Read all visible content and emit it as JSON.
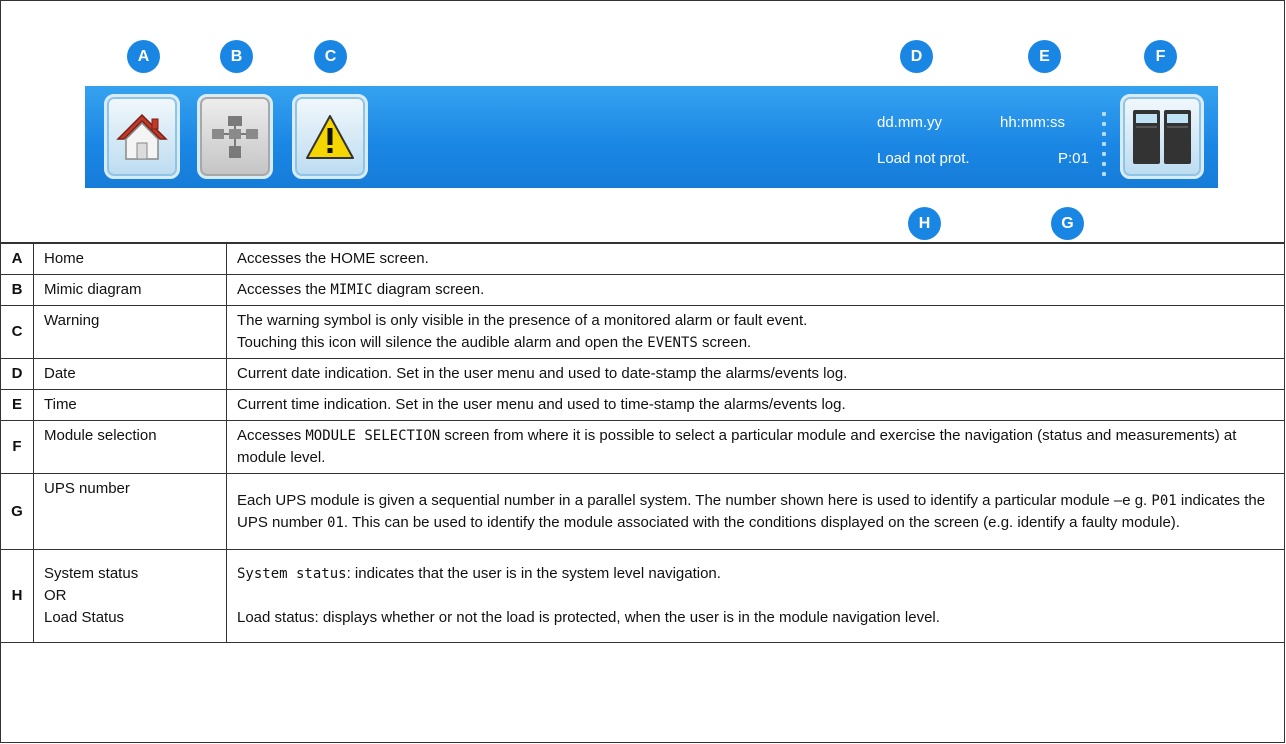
{
  "figure": {
    "badges": [
      "A",
      "B",
      "C",
      "D",
      "E",
      "F",
      "H",
      "G"
    ],
    "status_bar": {
      "date": "dd.mm.yy",
      "time": "hh:mm:ss",
      "load_status": "Load not prot.",
      "ups_number": "P:01",
      "bar_color": "#1a86e4",
      "badge_color": "#1a86e4"
    },
    "icons": [
      "home-icon",
      "mimic-diagram-icon",
      "warning-icon",
      "module-selection-icon"
    ]
  },
  "legend": {
    "rows": [
      {
        "key": "A",
        "label": "Home",
        "desc": [
          "Accesses the HOME screen."
        ]
      },
      {
        "key": "B",
        "label": "Mimic diagram",
        "desc_pre": "Accesses the ",
        "desc_mono": "MIMIC",
        "desc_post": " diagram screen."
      },
      {
        "key": "C",
        "label": "Warning",
        "desc1": "The warning symbol is only visible in the presence of a monitored alarm or fault event.",
        "desc2_pre": "Touching this icon will silence the audible alarm and open the ",
        "desc2_mono": "EVENTS",
        "desc2_post": " screen."
      },
      {
        "key": "D",
        "label": "Date",
        "desc": "Current date indication. Set in the user menu and used to date-stamp the alarms/events log."
      },
      {
        "key": "E",
        "label": "Time",
        "desc": "Current time indication. Set in the user menu and used to time-stamp the alarms/events log."
      },
      {
        "key": "F",
        "label": "Module selection",
        "desc_pre": "Accesses ",
        "desc_mono": "MODULE SELECTION",
        "desc_post": " screen from where it is possible to select a particular module and exercise the navigation (status and measurements) at module level."
      },
      {
        "key": "G",
        "label": "UPS number",
        "desc_a": "Each UPS module is given a sequential number in a parallel system. The number shown here is used to identify a particular module –e g. ",
        "mono_a": "P01",
        "desc_b": " indicates the UPS number ",
        "mono_b": "01",
        "desc_c": ". This can be used to identify the module associated with the conditions displayed on the screen (e.g. identify a faulty module)."
      },
      {
        "key": "H",
        "label_lines": [
          "System status",
          "OR",
          "Load Status"
        ],
        "desc1_mono": "System status",
        "desc1_post": ": indicates that the user is in the system level navigation.",
        "desc2": "Load status: displays whether or not the load is protected, when the user is in the module navigation level."
      }
    ]
  }
}
